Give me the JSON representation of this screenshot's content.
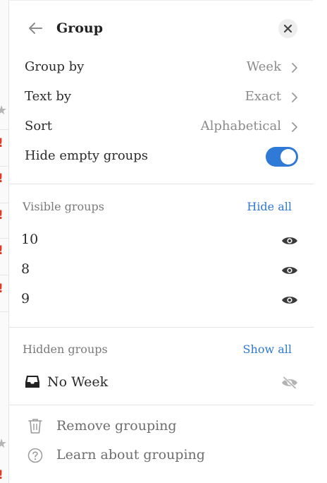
{
  "header": {
    "title": "Group",
    "back_icon": "arrow-left-icon",
    "close_icon": "close-icon"
  },
  "options": [
    {
      "label": "Group by",
      "value": "Week"
    },
    {
      "label": "Text by",
      "value": "Exact"
    },
    {
      "label": "Sort",
      "value": "Alphabetical"
    }
  ],
  "hide_empty": {
    "label": "Hide empty groups",
    "enabled": true,
    "accent": "#2e7ad6"
  },
  "visible_groups": {
    "title": "Visible groups",
    "action": "Hide all",
    "items": [
      "10",
      "8",
      "9"
    ]
  },
  "hidden_groups": {
    "title": "Hidden groups",
    "action": "Show all",
    "items": [
      "No Week"
    ]
  },
  "footer": {
    "remove": "Remove grouping",
    "learn": "Learn about grouping"
  },
  "colors": {
    "link": "#2e78d2",
    "toggle": "#2e7ad6",
    "alert": "#e03b24"
  }
}
